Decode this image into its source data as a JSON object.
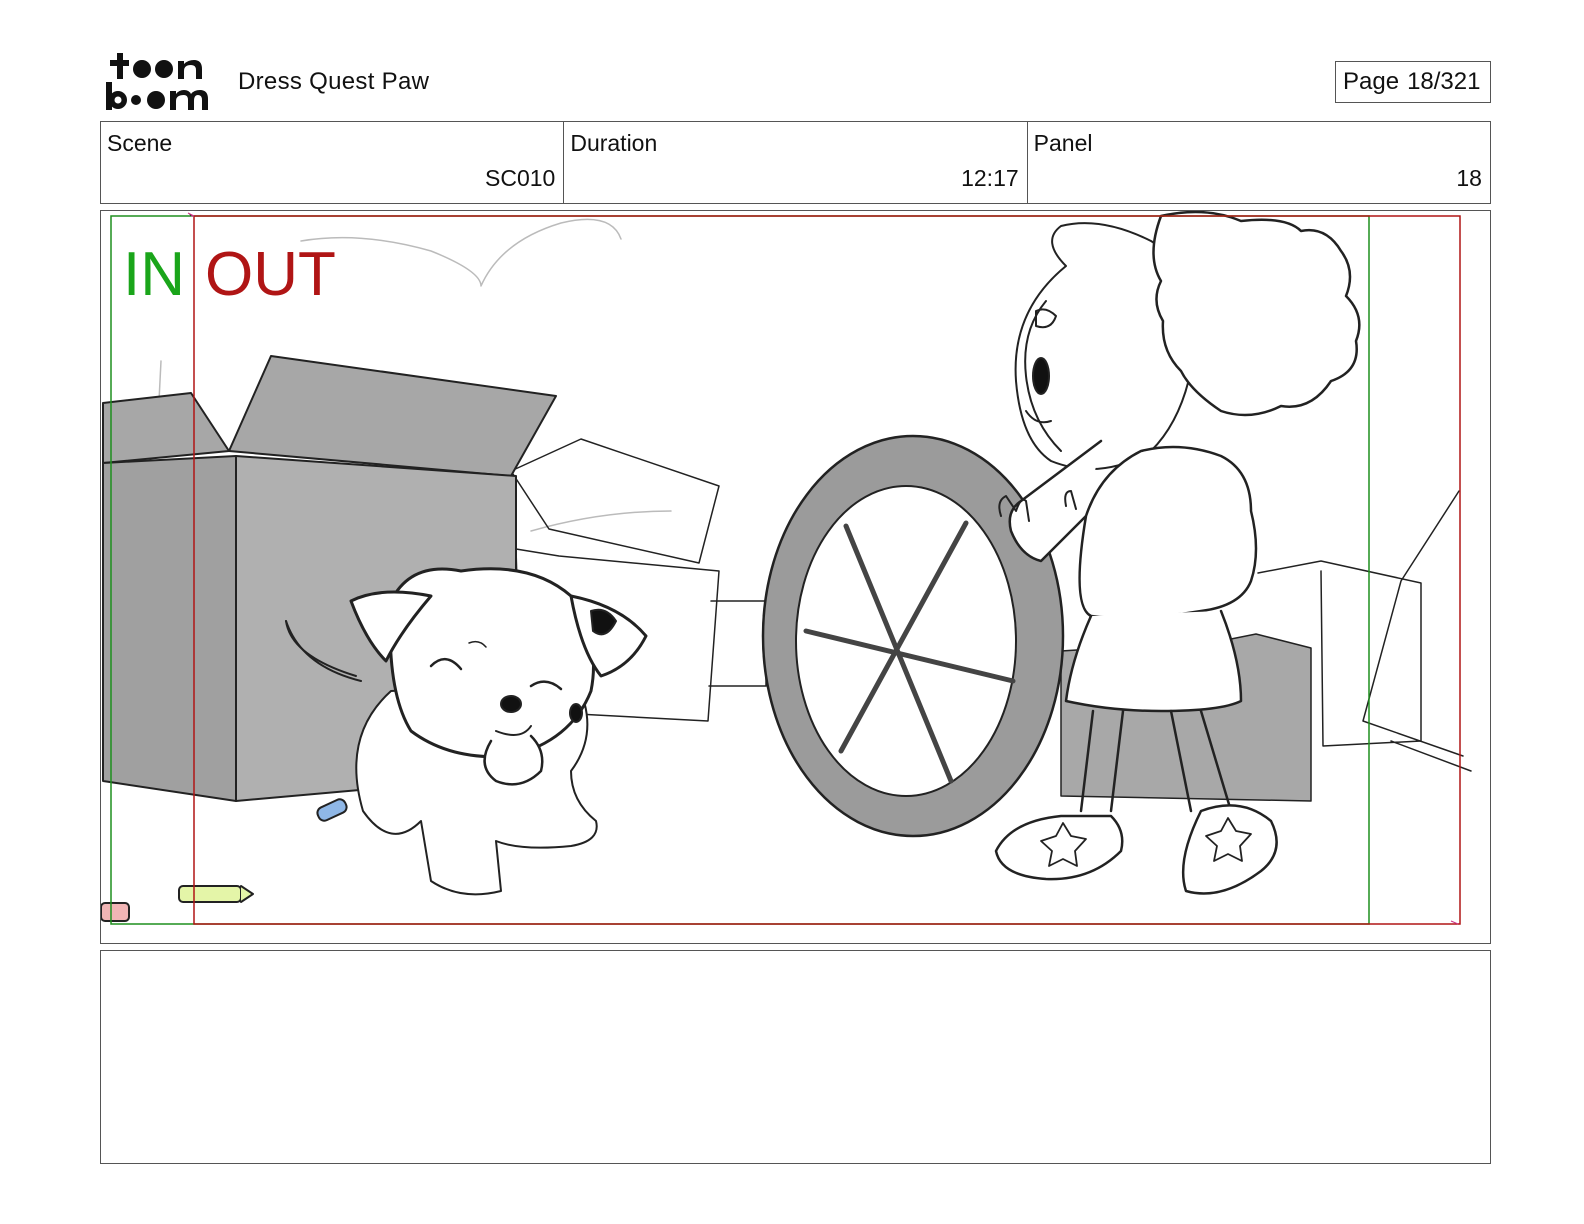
{
  "header": {
    "logo_text": "toonboom",
    "project_title": "Dress Quest Paw",
    "page_label": "Page",
    "page_value": "18/321"
  },
  "info": {
    "scene_label": "Scene",
    "scene_value": "SC010",
    "duration_label": "Duration",
    "duration_value": "12:17",
    "panel_label": "Panel",
    "panel_value": "18"
  },
  "panel": {
    "in_label": "IN",
    "out_label": "OUT",
    "in_color": "#1aa51a",
    "out_color": "#b01515"
  },
  "notes": {
    "text": ""
  }
}
